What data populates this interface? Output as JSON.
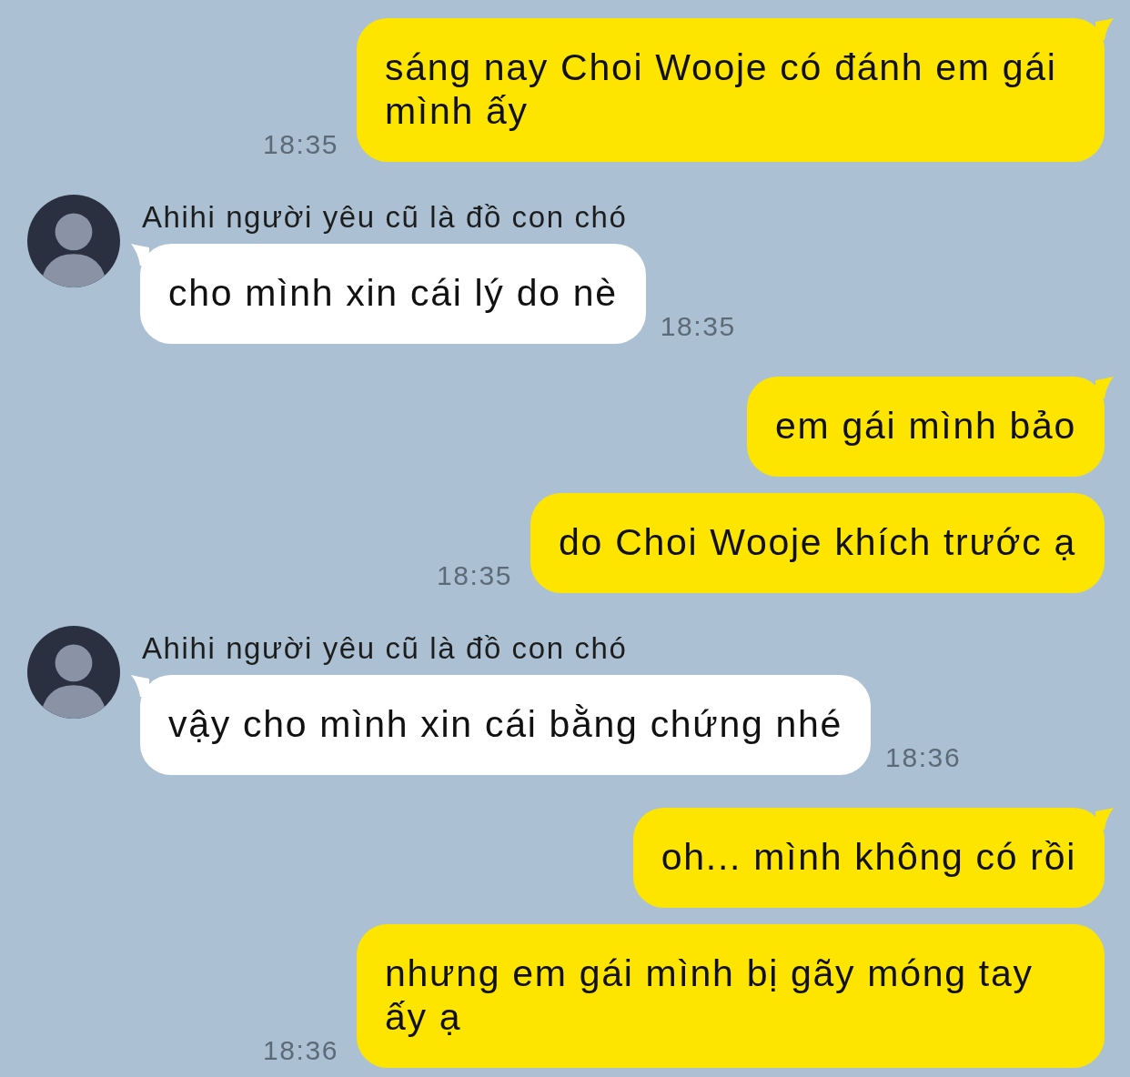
{
  "messages": [
    {
      "kind": "sent",
      "text": "sáng nay Choi Wooje có đánh em gái mình ấy",
      "tail": true,
      "time": "18:35"
    },
    {
      "kind": "received",
      "sender": "Ahihi người yêu cũ là đồ con chó",
      "text": "cho mình xin cái lý do nè",
      "tail": true,
      "time": "18:35"
    },
    {
      "kind": "sent",
      "text": "em gái mình bảo",
      "tail": true
    },
    {
      "kind": "sent",
      "text": "do Choi Wooje khích trước ạ",
      "tail": false,
      "time": "18:35"
    },
    {
      "kind": "received",
      "sender": "Ahihi người yêu cũ là đồ con chó",
      "text": "vậy cho mình xin cái bằng chứng nhé",
      "tail": true,
      "time": "18:36"
    },
    {
      "kind": "sent",
      "text": "oh... mình không có rồi",
      "tail": true
    },
    {
      "kind": "sent",
      "text": "nhưng em gái mình bị gãy móng tay ấy ạ",
      "tail": false,
      "time": "18:36"
    }
  ]
}
